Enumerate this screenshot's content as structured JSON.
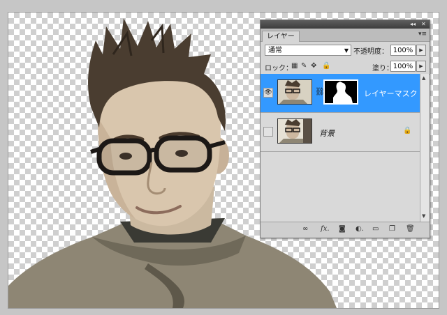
{
  "panel": {
    "title_buttons": {
      "collapse": "◂◂",
      "close": "✕"
    },
    "tab_label": "レイヤー",
    "menu_icon": "▾≡",
    "blend_mode": "通常",
    "opacity_label": "不透明度：",
    "opacity_value": "100%",
    "lock_label": "ロック：",
    "fill_label": "塗り：",
    "fill_value": "100%"
  },
  "layers": [
    {
      "name": "レイヤーマスク",
      "selected": true,
      "visible": true,
      "has_mask": true
    },
    {
      "name": "背景",
      "selected": false,
      "visible": false,
      "locked": true
    }
  ],
  "icons": {
    "lock_transparency": "lock-transparent-icon",
    "lock_brush": "lock-brush-icon",
    "lock_move": "lock-move-icon",
    "lock_all": "lock-all-icon",
    "footer": [
      "link-icon",
      "fx-icon",
      "mask-icon",
      "adjustment-icon",
      "folder-icon",
      "new-layer-icon",
      "trash-icon"
    ]
  },
  "footer_labels": {
    "link": "∞",
    "fx": "fx.",
    "mask": "◙",
    "adjust": "◐.",
    "folder": "▭",
    "new": "❐",
    "trash": "🗑"
  }
}
